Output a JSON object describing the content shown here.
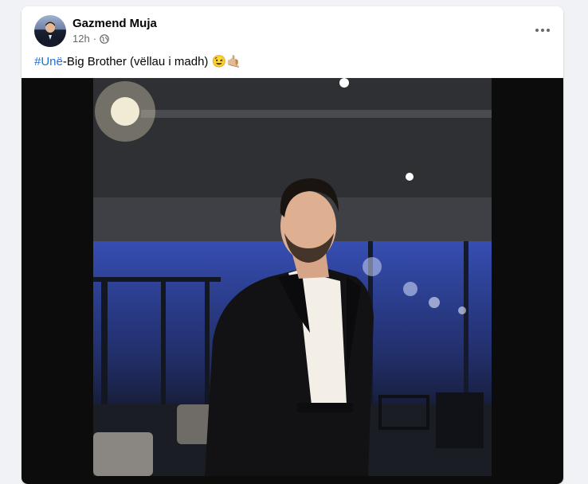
{
  "post": {
    "author": "Gazmend Muja",
    "time": "12h",
    "separator": "·",
    "audience_icon": "globe-icon",
    "more_icon": "more-options-icon",
    "caption": {
      "hashtag": "#Unë",
      "text": "-Big Brother (vëllau i madh) ",
      "emoji": "😉🤙🏼"
    }
  },
  "colors": {
    "page_bg": "#f0f2f5",
    "card_bg": "#ffffff",
    "link": "#216fdb",
    "secondary_text": "#65676b"
  }
}
